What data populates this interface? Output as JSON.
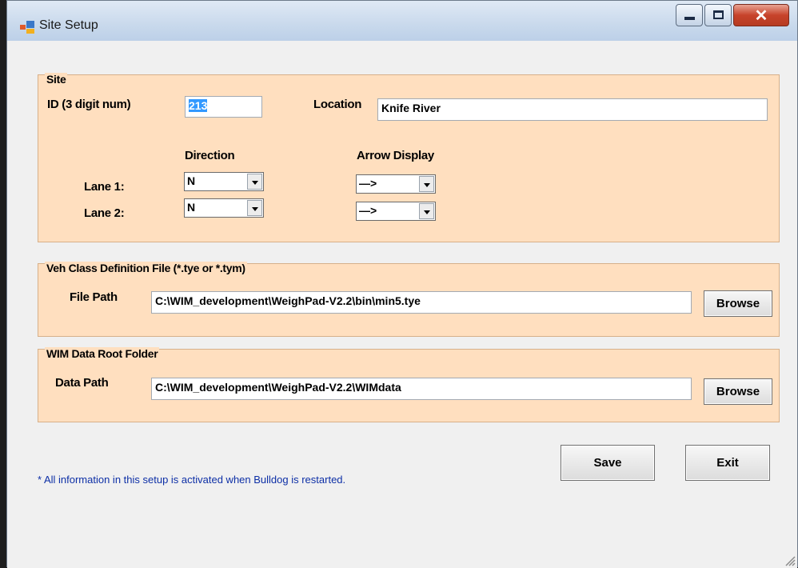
{
  "window": {
    "title": "Site Setup"
  },
  "site": {
    "legend": "Site",
    "id_label": "ID (3 digit num)",
    "id_value": "213",
    "location_label": "Location",
    "location_value": "Knife River",
    "direction_header": "Direction",
    "arrow_header": "Arrow Display",
    "lanes": [
      {
        "label": "Lane 1:",
        "direction": "N",
        "arrow": "—>"
      },
      {
        "label": "Lane 2:",
        "direction": "N",
        "arrow": "—>"
      }
    ]
  },
  "veh_class": {
    "legend": "Veh Class Definition File (*.tye or *.tym)",
    "path_label": "File Path",
    "path_value": "C:\\WIM_development\\WeighPad-V2.2\\bin\\min5.tye",
    "browse_label": "Browse"
  },
  "wim_data": {
    "legend": "WIM Data Root Folder",
    "path_label": "Data Path",
    "path_value": "C:\\WIM_development\\WeighPad-V2.2\\WIMdata",
    "browse_label": "Browse"
  },
  "actions": {
    "save_label": "Save",
    "exit_label": "Exit"
  },
  "footer_note": "* All information in this setup is activated when Bulldog is restarted.",
  "colors": {
    "group_bg": "#ffdfbf",
    "note_text": "#0d2fa6",
    "selection": "#3399ff"
  }
}
